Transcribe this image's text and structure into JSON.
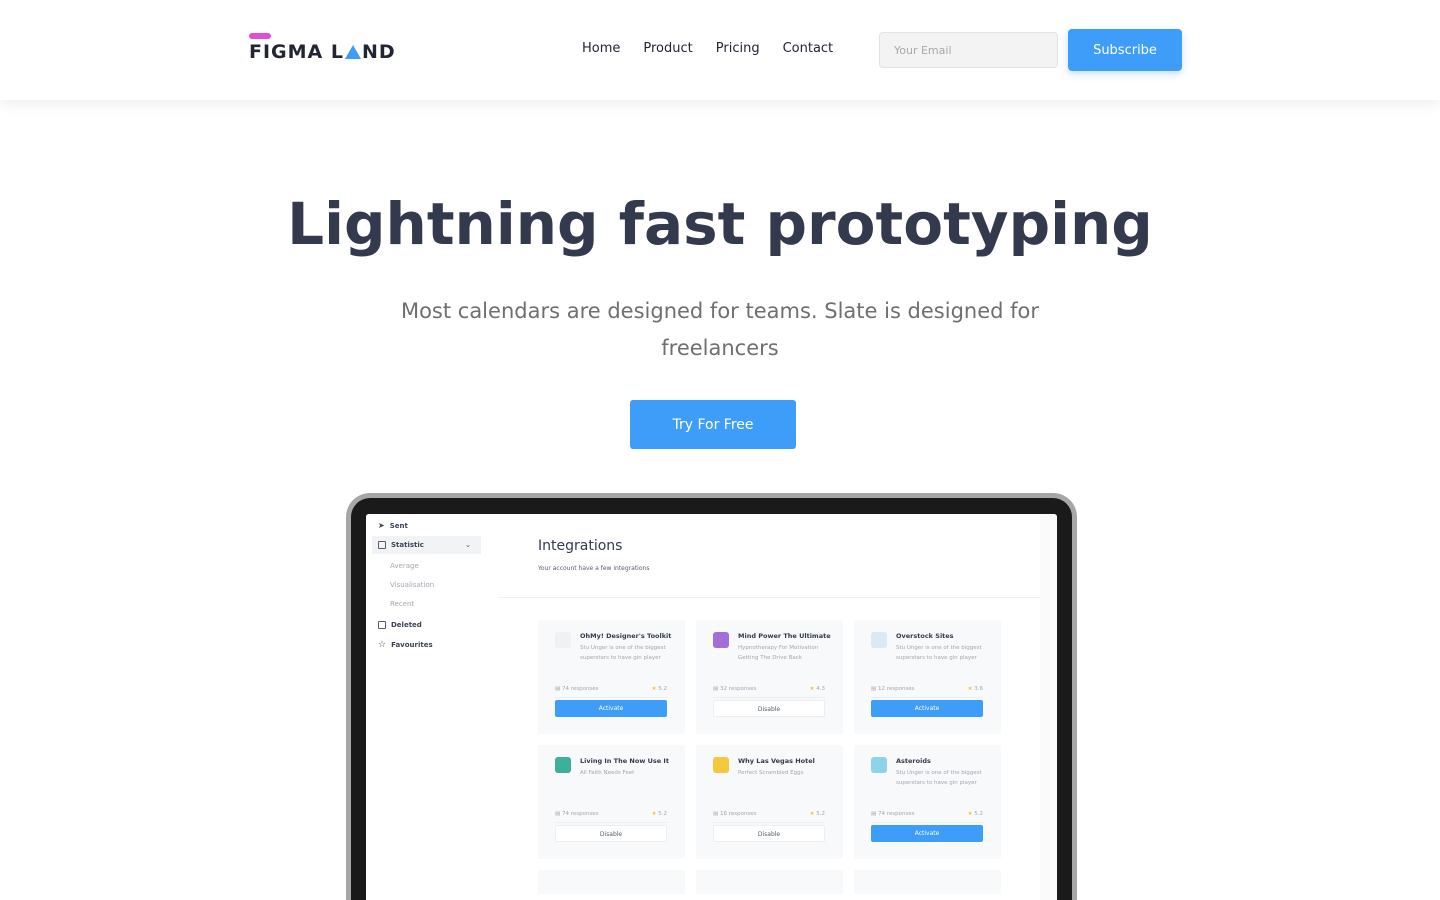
{
  "header": {
    "logo_text_1": "FIGMA L",
    "logo_text_2": "ND",
    "nav": [
      "Home",
      "Product",
      "Pricing",
      "Contact"
    ],
    "email_placeholder": "Your Email",
    "subscribe_label": "Subscribe"
  },
  "hero": {
    "title": "Lightning fast prototyping",
    "subtitle": "Most calendars are designed for teams. Slate is designed for freelancers",
    "cta_label": "Try For Free"
  },
  "app": {
    "sidebar": {
      "sent": "Sent",
      "statistic": "Statistic",
      "sub_items": [
        "Average",
        "Visualisation",
        "Recent"
      ],
      "deleted": "Deleted",
      "favourites": "Favourites"
    },
    "title": "Integrations",
    "subtitle": "Your account have a few integrations",
    "cards": [
      {
        "title": "OhMy! Designer's Toolkit",
        "desc": "Stu Unger is one of the biggest superstars to have gin player",
        "responses": "74 responses",
        "rating": "5.2",
        "button": "Activate",
        "logo_color": "#f1f1f1"
      },
      {
        "title": "Mind Power The Ultimate",
        "desc": "Hypnotherapy For Motivation Getting The Drive Back",
        "responses": "32 responses",
        "rating": "4.3",
        "button": "Disable",
        "logo_color": "#a46dd8"
      },
      {
        "title": "Overstock Sites",
        "desc": "Stu Unger is one of the biggest superstars to have gin player",
        "responses": "12 responses",
        "rating": "3.6",
        "button": "Activate",
        "logo_color": "#d9e9f7"
      },
      {
        "title": "Living In The Now Use It",
        "desc": "All Faith Needs Feet",
        "responses": "74 responses",
        "rating": "5.2",
        "button": "Disable",
        "logo_color": "#3eaf9d"
      },
      {
        "title": "Why Las Vegas Hotel",
        "desc": "Perfect Scrambled Eggs",
        "responses": "16 responses",
        "rating": "5.2",
        "button": "Disable",
        "logo_color": "#f5c93e"
      },
      {
        "title": "Asteroids",
        "desc": "Stu Unger is one of the biggest superstars to have gin player",
        "responses": "74 responses",
        "rating": "5.2",
        "button": "Activate",
        "logo_color": "#8fd3e8"
      }
    ]
  },
  "colors": {
    "accent": "#3f9dfa",
    "logo_bar": "#e14fd1",
    "heading": "#333a4d"
  }
}
